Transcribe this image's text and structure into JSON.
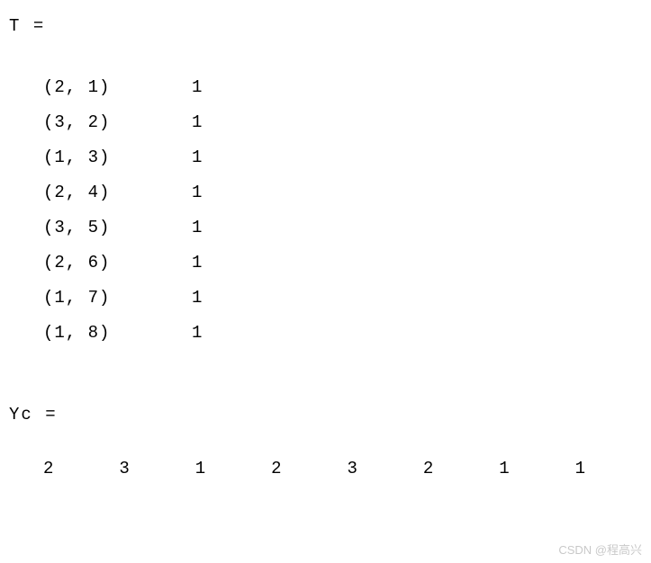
{
  "var1": {
    "name": "T",
    "eq": "=",
    "rows": [
      {
        "idx": "(2, 1)",
        "val": "1"
      },
      {
        "idx": "(3, 2)",
        "val": "1"
      },
      {
        "idx": "(1, 3)",
        "val": "1"
      },
      {
        "idx": "(2, 4)",
        "val": "1"
      },
      {
        "idx": "(3, 5)",
        "val": "1"
      },
      {
        "idx": "(2, 6)",
        "val": "1"
      },
      {
        "idx": "(1, 7)",
        "val": "1"
      },
      {
        "idx": "(1, 8)",
        "val": "1"
      }
    ]
  },
  "var2": {
    "name": "Yc",
    "eq": "=",
    "values": [
      "2",
      "3",
      "1",
      "2",
      "3",
      "2",
      "1",
      "1"
    ]
  },
  "watermark": "CSDN @程高兴"
}
